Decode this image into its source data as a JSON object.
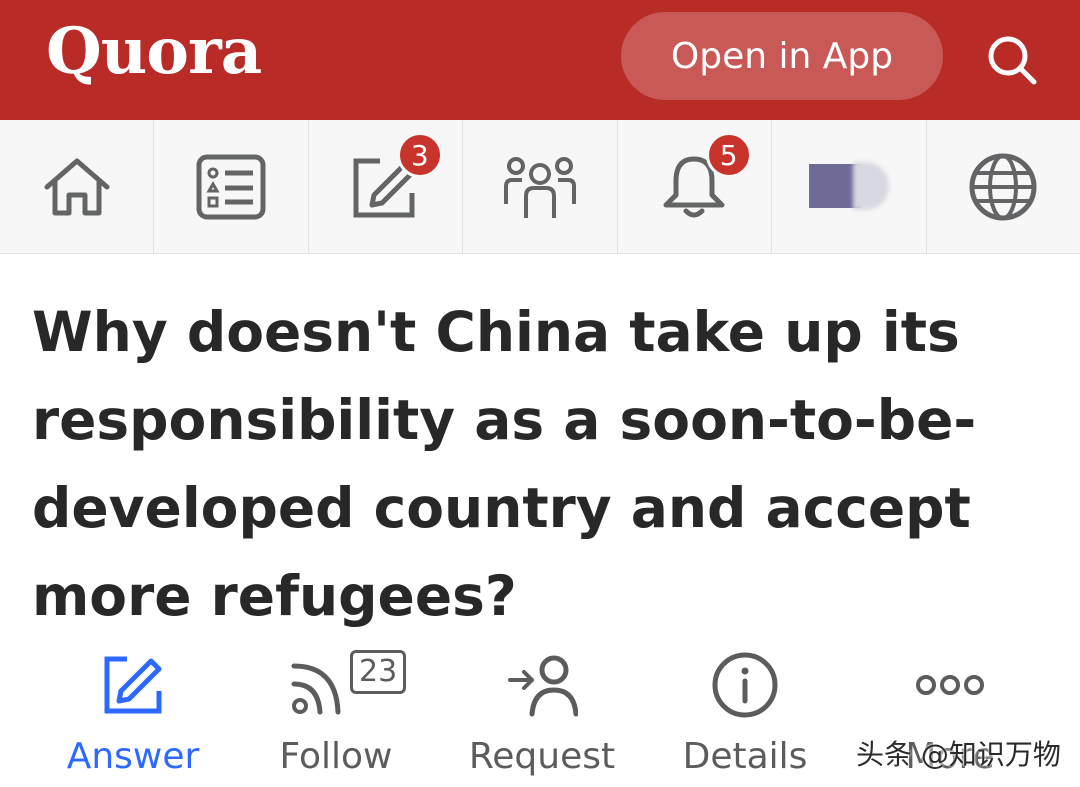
{
  "header": {
    "logo": "Quora",
    "open_app_label": "Open in App",
    "brand_color": "#b92b27"
  },
  "nav": {
    "items": [
      {
        "icon": "home-icon"
      },
      {
        "icon": "answer-feed-icon"
      },
      {
        "icon": "write-icon",
        "badge": "3"
      },
      {
        "icon": "spaces-icon"
      },
      {
        "icon": "notifications-bell-icon",
        "badge": "5"
      },
      {
        "icon": "profile-avatar"
      },
      {
        "icon": "globe-icon"
      }
    ]
  },
  "question": {
    "title": "Why doesn't China take up its responsibility as a soon-to-be-developed country and accept more refugees?"
  },
  "actions": {
    "answer_label": "Answer",
    "follow_label": "Follow",
    "follow_count": "23",
    "request_label": "Request",
    "details_label": "Details",
    "more_label": "More",
    "active_color": "#2e69ff"
  },
  "watermark": "头条 @知识万物"
}
